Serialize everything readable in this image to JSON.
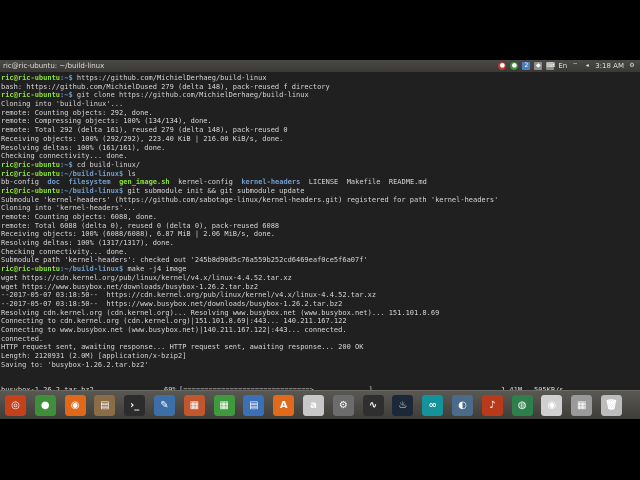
{
  "window": {
    "title": "ric@ric-ubuntu: ~/build-linux"
  },
  "tray": {
    "keyboard": "En",
    "time": "3:18 AM"
  },
  "terminal": {
    "prompt_user": "ric@ric-ubuntu",
    "lines": [
      {
        "kind": "prompt",
        "path": ":~$",
        "cmd": " https://github.com/MichielDerhaeg/build-linux"
      },
      {
        "kind": "text",
        "text": "bash: https://github.com/MichielDused 279 (delta 148), pack-reused f directory"
      },
      {
        "kind": "prompt",
        "path": ":~$",
        "cmd": " git clone https://github.com/MichielDerhaeg/build-linux"
      },
      {
        "kind": "text",
        "text": "Cloning into 'build-linux'..."
      },
      {
        "kind": "text",
        "text": "remote: Counting objects: 292, done."
      },
      {
        "kind": "text",
        "text": "remote: Compressing objects: 100% (134/134), done."
      },
      {
        "kind": "text",
        "text": "remote: Total 292 (delta 161), reused 279 (delta 148), pack-reused 0"
      },
      {
        "kind": "text",
        "text": "Receiving objects: 100% (292/292), 223.40 KiB | 216.00 KiB/s, done."
      },
      {
        "kind": "text",
        "text": "Resolving deltas: 100% (161/161), done."
      },
      {
        "kind": "text",
        "text": "Checking connectivity... done."
      },
      {
        "kind": "prompt",
        "path": ":~$",
        "cmd": " cd build-linux/"
      },
      {
        "kind": "prompt",
        "path": ":~/build-linux$",
        "cmd": " ls"
      },
      {
        "kind": "ls"
      },
      {
        "kind": "prompt",
        "path": ":~/build-linux$",
        "cmd": " git submodule init && git submodule update"
      },
      {
        "kind": "text",
        "text": "Submodule 'kernel-headers' (https://github.com/sabotage-linux/kernel-headers.git) registered for path 'kernel-headers'"
      },
      {
        "kind": "text",
        "text": "Cloning into 'kernel-headers'..."
      },
      {
        "kind": "text",
        "text": "remote: Counting objects: 6088, done."
      },
      {
        "kind": "text",
        "text": "remote: Total 6088 (delta 0), reused 0 (delta 0), pack-reused 6088"
      },
      {
        "kind": "text",
        "text": "Receiving objects: 100% (6088/6088), 6.87 MiB | 2.06 MiB/s, done."
      },
      {
        "kind": "text",
        "text": "Resolving deltas: 100% (1317/1317), done."
      },
      {
        "kind": "text",
        "text": "Checking connectivity... done."
      },
      {
        "kind": "text",
        "text": "Submodule path 'kernel-headers': checked out '245b8d90d5c76a559b252cd6469eaf0ce5f6a07f'"
      },
      {
        "kind": "prompt",
        "path": ":~/build-linux$",
        "cmd": " make -j4 image"
      },
      {
        "kind": "text",
        "text": "wget https://cdn.kernel.org/pub/linux/kernel/v4.x/linux-4.4.52.tar.xz"
      },
      {
        "kind": "text",
        "text": "wget https://www.busybox.net/downloads/busybox-1.26.2.tar.bz2"
      },
      {
        "kind": "text",
        "text": "--2017-05-07 03:18:50--  https://cdn.kernel.org/pub/linux/kernel/v4.x/linux-4.4.52.tar.xz"
      },
      {
        "kind": "text",
        "text": "--2017-05-07 03:18:50--  https://www.busybox.net/downloads/busybox-1.26.2.tar.bz2"
      },
      {
        "kind": "text",
        "text": "Resolving cdn.kernel.org (cdn.kernel.org)... Resolving www.busybox.net (www.busybox.net)... 151.101.8.69"
      },
      {
        "kind": "text",
        "text": "Connecting to cdn.kernel.org (cdn.kernel.org)|151.101.8.69|:443... 140.211.167.122"
      },
      {
        "kind": "text",
        "text": "Connecting to www.busybox.net (www.busybox.net)|140.211.167.122|:443... connected."
      },
      {
        "kind": "text",
        "text": "connected."
      },
      {
        "kind": "text",
        "text": "HTTP request sent, awaiting response... HTTP request sent, awaiting response... 200 OK"
      },
      {
        "kind": "text",
        "text": "Length: 2120931 (2.0M) [application/x-bzip2]"
      },
      {
        "kind": "text",
        "text": "Saving to: 'busybox-1.26.2.tar.bz2'"
      },
      {
        "kind": "text",
        "text": ""
      }
    ],
    "ls_items": [
      {
        "name": "bb-config",
        "cls": ""
      },
      {
        "name": "doc",
        "cls": "dir"
      },
      {
        "name": "filesystem",
        "cls": "dir"
      },
      {
        "name": "gen_image.sh",
        "cls": "exe"
      },
      {
        "name": "kernel-config",
        "cls": ""
      },
      {
        "name": "kernel-headers",
        "cls": "dir"
      },
      {
        "name": "LICENSE",
        "cls": ""
      },
      {
        "name": "Makefile",
        "cls": ""
      },
      {
        "name": "README.md",
        "cls": ""
      }
    ],
    "progress": {
      "file": "busybox-1.26.2.tar.bz2",
      "percent_text": "69%",
      "fraction": 0.69,
      "size": "1.41M",
      "speed": "505KB/s"
    }
  },
  "launcher": {
    "apps": [
      {
        "name": "ubuntu-dash-icon",
        "color": "#c5411b",
        "glyph": "◎"
      },
      {
        "name": "chrome-icon",
        "color": "#3f8f3a",
        "glyph": "●"
      },
      {
        "name": "firefox-icon",
        "color": "#e0681a",
        "glyph": "◉"
      },
      {
        "name": "files-icon",
        "color": "#8a6d46",
        "glyph": "▤"
      },
      {
        "name": "terminal-icon",
        "color": "#2c2c2c",
        "glyph": "›_"
      },
      {
        "name": "text-editor-icon",
        "color": "#3c6ea7",
        "glyph": "✎"
      },
      {
        "name": "impress-icon",
        "color": "#c2562c",
        "glyph": "▦"
      },
      {
        "name": "calc-icon",
        "color": "#3f9a3f",
        "glyph": "▦"
      },
      {
        "name": "writer-icon",
        "color": "#3b6fb6",
        "glyph": "▤"
      },
      {
        "name": "software-center-icon",
        "color": "#e06a1c",
        "glyph": "A"
      },
      {
        "name": "amazon-icon",
        "color": "#c8c8c8",
        "glyph": "a"
      },
      {
        "name": "settings-icon",
        "color": "#6c6c6c",
        "glyph": "⚙"
      },
      {
        "name": "system-monitor-icon",
        "color": "#2f2f2f",
        "glyph": "∿"
      },
      {
        "name": "steam-icon",
        "color": "#1b2838",
        "glyph": "♨"
      },
      {
        "name": "arduino-icon",
        "color": "#15939a",
        "glyph": "∞"
      },
      {
        "name": "vpn-icon",
        "color": "#4a6b8a",
        "glyph": "◐"
      },
      {
        "name": "audio-icon",
        "color": "#b83a1a",
        "glyph": "♪"
      },
      {
        "name": "globe-icon",
        "color": "#2f7f4a",
        "glyph": "◍"
      },
      {
        "name": "webcam-icon",
        "color": "#d0d0d0",
        "glyph": "◉"
      },
      {
        "name": "workspace-icon",
        "color": "#9a9a9a",
        "glyph": "▦"
      },
      {
        "name": "trash-icon",
        "color": "#bcbcbc",
        "glyph": "🗑"
      }
    ]
  }
}
